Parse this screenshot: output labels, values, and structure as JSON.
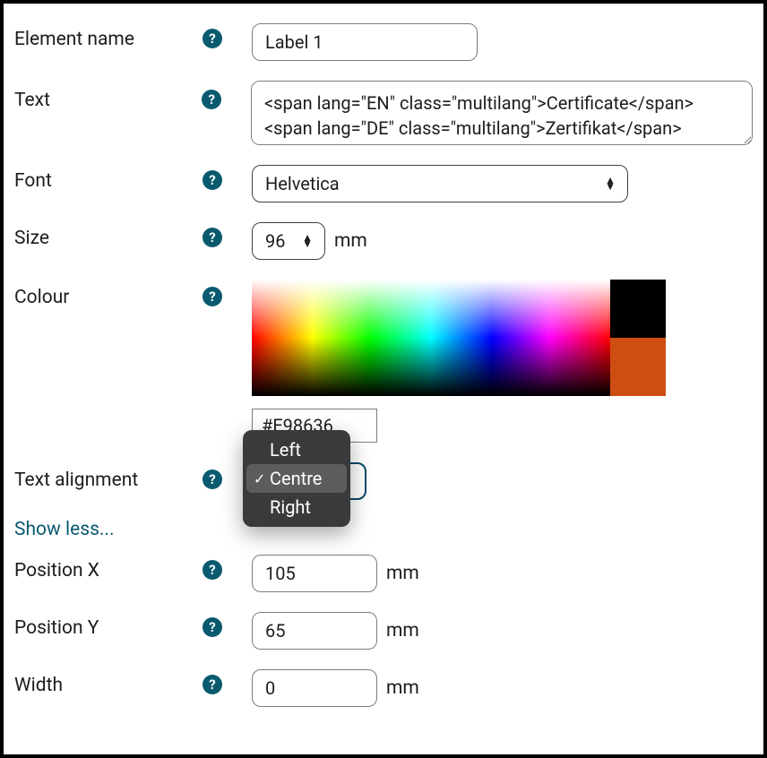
{
  "form": {
    "element_name": {
      "label": "Element name",
      "value": "Label 1"
    },
    "text": {
      "label": "Text",
      "value": "<span lang=\"EN\" class=\"multilang\">Certificate</span> <span lang=\"DE\" class=\"multilang\">Zertifikat</span>"
    },
    "font": {
      "label": "Font",
      "value": "Helvetica"
    },
    "size": {
      "label": "Size",
      "value": "96",
      "unit": "mm"
    },
    "colour": {
      "label": "Colour",
      "hex": "#E98636",
      "swatch_black": "#000000",
      "swatch_current": "#CE4D13"
    },
    "text_alignment": {
      "label": "Text alignment",
      "options": {
        "left": "Left",
        "centre": "Centre",
        "right": "Right"
      },
      "selected": "Centre"
    },
    "show_less": "Show less...",
    "position_x": {
      "label": "Position X",
      "value": "105",
      "unit": "mm"
    },
    "position_y": {
      "label": "Position Y",
      "value": "65",
      "unit": "mm"
    },
    "width": {
      "label": "Width",
      "value": "0",
      "unit": "mm"
    },
    "help_glyph": "?"
  }
}
